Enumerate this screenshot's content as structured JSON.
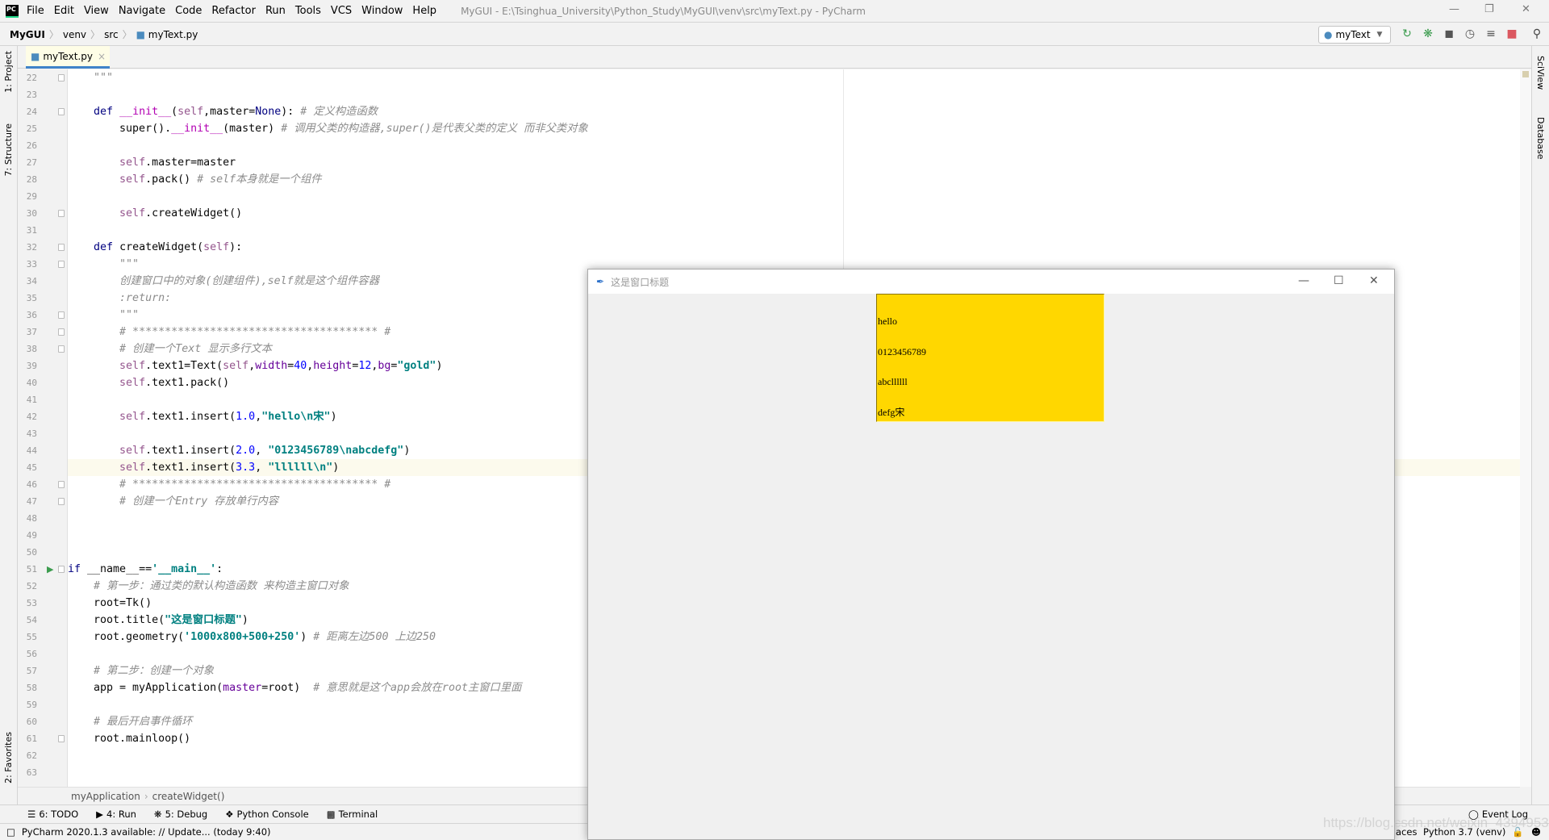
{
  "ide": {
    "menu": [
      "File",
      "Edit",
      "View",
      "Navigate",
      "Code",
      "Refactor",
      "Run",
      "Tools",
      "VCS",
      "Window",
      "Help"
    ],
    "window_title": "MyGUI - E:\\Tsinghua_University\\Python_Study\\MyGUI\\venv\\src\\myText.py - PyCharm",
    "breadcrumb": [
      "MyGUI",
      "venv",
      "src",
      "myText.py"
    ],
    "run_config": "myText",
    "tab": "myText.py",
    "left_tools": [
      "1: Project",
      "7: Structure",
      "2: Favorites"
    ],
    "right_tools": [
      "SciView",
      "Database"
    ],
    "editor_breadcrumb": [
      "myApplication",
      "createWidget()"
    ],
    "tool_windows": [
      "6: TODO",
      "4: Run",
      "5: Debug",
      "Python Console",
      "Terminal"
    ],
    "event_log": "Event Log",
    "status_left": "PyCharm 2020.1.3 available: // Update... (today 9:40)",
    "status_right_partial": "aces",
    "interpreter": "Python 3.7 (venv)",
    "watermark": "https://blog.csdn.net/weixin_43949535",
    "highlighted_line": 45
  },
  "code": [
    {
      "n": 22,
      "t": [
        [
          "plain",
          "    "
        ],
        [
          "doc",
          "\"\"\""
        ]
      ]
    },
    {
      "n": 23,
      "t": []
    },
    {
      "n": 24,
      "t": [
        [
          "plain",
          "    "
        ],
        [
          "kw",
          "def "
        ],
        [
          "fn",
          "__init__"
        ],
        [
          "plain",
          "("
        ],
        [
          "self",
          "self"
        ],
        [
          "plain",
          ",master="
        ],
        [
          "kw",
          "None"
        ],
        [
          "plain",
          "): "
        ],
        [
          "cmt",
          "# 定义构造函数"
        ]
      ]
    },
    {
      "n": 25,
      "t": [
        [
          "plain",
          "        super()."
        ],
        [
          "fn",
          "__init__"
        ],
        [
          "plain",
          "(master) "
        ],
        [
          "cmt",
          "# 调用父类的构造器,super()是代表父类的定义 而非父类对象"
        ]
      ]
    },
    {
      "n": 26,
      "t": []
    },
    {
      "n": 27,
      "t": [
        [
          "plain",
          "        "
        ],
        [
          "self",
          "self"
        ],
        [
          "plain",
          ".master=master"
        ]
      ]
    },
    {
      "n": 28,
      "t": [
        [
          "plain",
          "        "
        ],
        [
          "self",
          "self"
        ],
        [
          "plain",
          ".pack() "
        ],
        [
          "cmt",
          "# self本身就是一个组件"
        ]
      ]
    },
    {
      "n": 29,
      "t": []
    },
    {
      "n": 30,
      "t": [
        [
          "plain",
          "        "
        ],
        [
          "self",
          "self"
        ],
        [
          "plain",
          ".createWidget()"
        ]
      ]
    },
    {
      "n": 31,
      "t": []
    },
    {
      "n": 32,
      "t": [
        [
          "plain",
          "    "
        ],
        [
          "kw",
          "def "
        ],
        [
          "plain",
          "createWidget("
        ],
        [
          "self",
          "self"
        ],
        [
          "plain",
          "):"
        ]
      ]
    },
    {
      "n": 33,
      "t": [
        [
          "plain",
          "        "
        ],
        [
          "doc",
          "\"\"\""
        ]
      ]
    },
    {
      "n": 34,
      "t": [
        [
          "plain",
          "        "
        ],
        [
          "doc",
          "创建窗口中的对象(创建组件),self就是这个组件容器"
        ]
      ]
    },
    {
      "n": 35,
      "t": [
        [
          "plain",
          "        "
        ],
        [
          "doc",
          ":return:"
        ]
      ]
    },
    {
      "n": 36,
      "t": [
        [
          "plain",
          "        "
        ],
        [
          "doc",
          "\"\"\""
        ]
      ]
    },
    {
      "n": 37,
      "t": [
        [
          "plain",
          "        "
        ],
        [
          "cmt",
          "# ************************************** #"
        ]
      ]
    },
    {
      "n": 38,
      "t": [
        [
          "plain",
          "        "
        ],
        [
          "cmt",
          "# 创建一个Text 显示多行文本"
        ]
      ]
    },
    {
      "n": 39,
      "t": [
        [
          "plain",
          "        "
        ],
        [
          "self",
          "self"
        ],
        [
          "plain",
          ".text1=Text("
        ],
        [
          "self",
          "self"
        ],
        [
          "plain",
          ","
        ],
        [
          "param",
          "width"
        ],
        [
          "plain",
          "="
        ],
        [
          "num",
          "40"
        ],
        [
          "plain",
          ","
        ],
        [
          "param",
          "height"
        ],
        [
          "plain",
          "="
        ],
        [
          "num",
          "12"
        ],
        [
          "plain",
          ","
        ],
        [
          "param",
          "bg"
        ],
        [
          "plain",
          "="
        ],
        [
          "str",
          "\"gold\""
        ],
        [
          "plain",
          ")"
        ]
      ]
    },
    {
      "n": 40,
      "t": [
        [
          "plain",
          "        "
        ],
        [
          "self",
          "self"
        ],
        [
          "plain",
          ".text1.pack()"
        ]
      ]
    },
    {
      "n": 41,
      "t": []
    },
    {
      "n": 42,
      "t": [
        [
          "plain",
          "        "
        ],
        [
          "self",
          "self"
        ],
        [
          "plain",
          ".text1.insert("
        ],
        [
          "num",
          "1.0"
        ],
        [
          "plain",
          ","
        ],
        [
          "str",
          "\"hello\\n宋\""
        ],
        [
          "plain",
          ")"
        ]
      ]
    },
    {
      "n": 43,
      "t": []
    },
    {
      "n": 44,
      "t": [
        [
          "plain",
          "        "
        ],
        [
          "self",
          "self"
        ],
        [
          "plain",
          ".text1.insert("
        ],
        [
          "num",
          "2.0"
        ],
        [
          "plain",
          ", "
        ],
        [
          "str",
          "\"0123456789\\nabcdefg\""
        ],
        [
          "plain",
          ")"
        ]
      ]
    },
    {
      "n": 45,
      "t": [
        [
          "plain",
          "        "
        ],
        [
          "self",
          "self"
        ],
        [
          "plain",
          ".text1.insert("
        ],
        [
          "num",
          "3.3"
        ],
        [
          "plain",
          ", "
        ],
        [
          "str",
          "\"llllll\\n\""
        ],
        [
          "plain",
          ")"
        ]
      ]
    },
    {
      "n": 46,
      "t": [
        [
          "plain",
          "        "
        ],
        [
          "cmt",
          "# ************************************** #"
        ]
      ]
    },
    {
      "n": 47,
      "t": [
        [
          "plain",
          "        "
        ],
        [
          "cmt",
          "# 创建一个Entry 存放单行内容"
        ]
      ]
    },
    {
      "n": 48,
      "t": []
    },
    {
      "n": 49,
      "t": []
    },
    {
      "n": 50,
      "t": []
    },
    {
      "n": 51,
      "t": [
        [
          "kw",
          "if "
        ],
        [
          "plain",
          "__name__=="
        ],
        [
          "str",
          "'__main__'"
        ],
        [
          "plain",
          ":"
        ]
      ]
    },
    {
      "n": 52,
      "t": [
        [
          "plain",
          "    "
        ],
        [
          "cmt",
          "# 第一步：通过类的默认构造函数 来构造主窗口对象"
        ]
      ]
    },
    {
      "n": 53,
      "t": [
        [
          "plain",
          "    root=Tk()"
        ]
      ]
    },
    {
      "n": 54,
      "t": [
        [
          "plain",
          "    root.title("
        ],
        [
          "str",
          "\"这是窗口标题\""
        ],
        [
          "plain",
          ")"
        ]
      ]
    },
    {
      "n": 55,
      "t": [
        [
          "plain",
          "    root.geometry("
        ],
        [
          "str",
          "'1000x800+500+250'"
        ],
        [
          "plain",
          ") "
        ],
        [
          "cmt",
          "# 距离左边500 上边250"
        ]
      ]
    },
    {
      "n": 56,
      "t": []
    },
    {
      "n": 57,
      "t": [
        [
          "plain",
          "    "
        ],
        [
          "cmt",
          "# 第二步：创建一个对象"
        ]
      ]
    },
    {
      "n": 58,
      "t": [
        [
          "plain",
          "    app = myApplication("
        ],
        [
          "param",
          "master"
        ],
        [
          "plain",
          "=root)  "
        ],
        [
          "cmt",
          "# 意思就是这个app会放在root主窗口里面"
        ]
      ]
    },
    {
      "n": 59,
      "t": []
    },
    {
      "n": 60,
      "t": [
        [
          "plain",
          "    "
        ],
        [
          "cmt",
          "# 最后开启事件循环"
        ]
      ]
    },
    {
      "n": 61,
      "t": [
        [
          "plain",
          "    root.mainloop()"
        ]
      ]
    },
    {
      "n": 62,
      "t": []
    },
    {
      "n": 63,
      "t": []
    }
  ],
  "fold_lines": [
    22,
    24,
    30,
    32,
    33,
    36,
    37,
    38,
    46,
    47,
    51,
    61
  ],
  "tk_window": {
    "title": "这是窗口标题",
    "text_widget_lines": [
      "hello",
      "0123456789",
      "abcllllll",
      "defg宋"
    ],
    "text_bg": "#ffd700"
  }
}
